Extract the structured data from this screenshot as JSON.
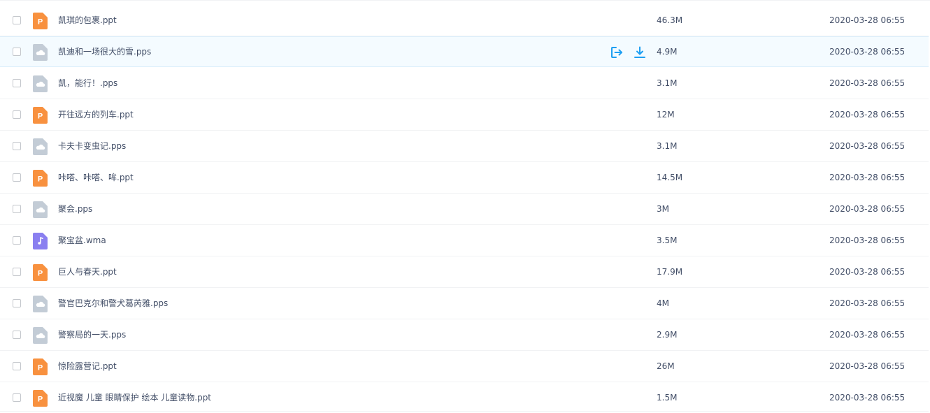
{
  "colors": {
    "ppt_icon": "#f8913f",
    "pps_icon": "#c3ccd6",
    "audio_icon": "#8a7ff0",
    "action_icon": "#1e9ff2",
    "text": "#424e67"
  },
  "hover_actions": {
    "share_icon": "share-export-icon",
    "download_icon": "download-icon"
  },
  "files": [
    {
      "name": "凯琪的包裹.ppt",
      "size": "46.3M",
      "date": "2020-03-28 06:55",
      "icon": "ppt-icon"
    },
    {
      "name": "凯迪和一场很大的雪.pps",
      "size": "4.9M",
      "date": "2020-03-28 06:55",
      "icon": "pps-icon"
    },
    {
      "name": "凯，能行！.pps",
      "size": "3.1M",
      "date": "2020-03-28 06:55",
      "icon": "pps-icon"
    },
    {
      "name": "开往远方的列车.ppt",
      "size": "12M",
      "date": "2020-03-28 06:55",
      "icon": "ppt-icon"
    },
    {
      "name": "卡夫卡变虫记.pps",
      "size": "3.1M",
      "date": "2020-03-28 06:55",
      "icon": "pps-icon"
    },
    {
      "name": "咔嗒、咔嗒、哞.ppt",
      "size": "14.5M",
      "date": "2020-03-28 06:55",
      "icon": "ppt-icon"
    },
    {
      "name": "聚会.pps",
      "size": "3M",
      "date": "2020-03-28 06:55",
      "icon": "pps-icon"
    },
    {
      "name": "聚宝盆.wma",
      "size": "3.5M",
      "date": "2020-03-28 06:55",
      "icon": "audio-icon"
    },
    {
      "name": "巨人与春天.ppt",
      "size": "17.9M",
      "date": "2020-03-28 06:55",
      "icon": "ppt-icon"
    },
    {
      "name": "警官巴克尔和警犬葛芮雅.pps",
      "size": "4M",
      "date": "2020-03-28 06:55",
      "icon": "pps-icon"
    },
    {
      "name": "警察局的一天.pps",
      "size": "2.9M",
      "date": "2020-03-28 06:55",
      "icon": "pps-icon"
    },
    {
      "name": "惊险露营记.ppt",
      "size": "26M",
      "date": "2020-03-28 06:55",
      "icon": "ppt-icon"
    },
    {
      "name": "近视魔 儿童 眼睛保护 绘本 儿童读物.ppt",
      "size": "1.5M",
      "date": "2020-03-28 06:55",
      "icon": "ppt-icon"
    }
  ]
}
